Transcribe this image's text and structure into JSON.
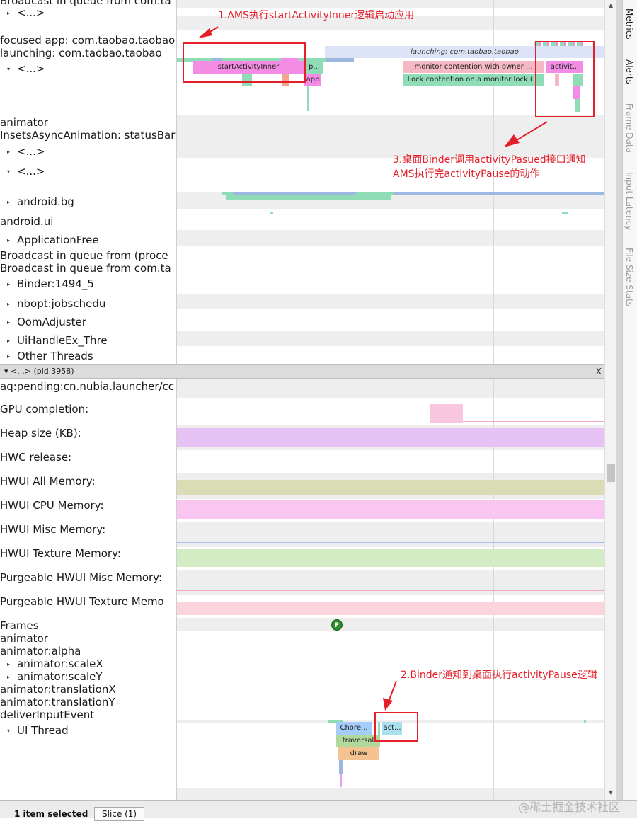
{
  "labels_top": [
    {
      "text": "Broadcast in queue from com.ta",
      "indent": false,
      "tri": ""
    },
    {
      "text": "<...>",
      "indent": true,
      "tri": "▸"
    },
    {
      "text": "focused app: com.taobao.taobao",
      "indent": false,
      "tri": ""
    },
    {
      "text": "launching: com.taobao.taobao",
      "indent": false,
      "tri": ""
    },
    {
      "text": "<...>",
      "indent": true,
      "tri": "▾"
    },
    {
      "text": "animator",
      "indent": false,
      "tri": ""
    },
    {
      "text": "InsetsAsyncAnimation: statusBar",
      "indent": false,
      "tri": ""
    },
    {
      "text": "<...>",
      "indent": true,
      "tri": "▸"
    },
    {
      "text": "<...>",
      "indent": true,
      "tri": "▾"
    },
    {
      "text": "android.bg",
      "indent": true,
      "tri": "▸"
    },
    {
      "text": "android.ui",
      "indent": false,
      "tri": ""
    },
    {
      "text": "ApplicationFree",
      "indent": true,
      "tri": "▸"
    },
    {
      "text": "Broadcast in queue from (proce",
      "indent": false,
      "tri": ""
    },
    {
      "text": "Broadcast in queue from com.ta",
      "indent": false,
      "tri": ""
    },
    {
      "text": "Binder:1494_5",
      "indent": true,
      "tri": "▸"
    },
    {
      "text": "nbopt:jobschedu",
      "indent": true,
      "tri": "▸"
    },
    {
      "text": "OomAdjuster",
      "indent": true,
      "tri": "▸"
    },
    {
      "text": "UiHandleEx_Thre",
      "indent": true,
      "tri": "▸"
    },
    {
      "text": "Other Threads",
      "indent": true,
      "tri": "▸"
    }
  ],
  "process_header": {
    "label": "▾ <...> (pid 3958)",
    "close": "X"
  },
  "labels_bottom": [
    {
      "text": "aq:pending:cn.nubia.launcher/cc",
      "indent": false,
      "tri": ""
    },
    {
      "text": "GPU completion:",
      "indent": false,
      "tri": ""
    },
    {
      "text": "Heap size (KB):",
      "indent": false,
      "tri": ""
    },
    {
      "text": "HWC release:",
      "indent": false,
      "tri": ""
    },
    {
      "text": "HWUI All Memory:",
      "indent": false,
      "tri": ""
    },
    {
      "text": "HWUI CPU Memory:",
      "indent": false,
      "tri": ""
    },
    {
      "text": "HWUI Misc Memory:",
      "indent": false,
      "tri": ""
    },
    {
      "text": "HWUI Texture Memory:",
      "indent": false,
      "tri": ""
    },
    {
      "text": "Purgeable HWUI Misc Memory:",
      "indent": false,
      "tri": ""
    },
    {
      "text": "Purgeable HWUI Texture Memo",
      "indent": false,
      "tri": ""
    },
    {
      "text": "Frames",
      "indent": false,
      "tri": ""
    },
    {
      "text": "animator",
      "indent": false,
      "tri": ""
    },
    {
      "text": "animator:alpha",
      "indent": false,
      "tri": ""
    },
    {
      "text": "animator:scaleX",
      "indent": true,
      "tri": "▸"
    },
    {
      "text": "animator:scaleY",
      "indent": true,
      "tri": "▸"
    },
    {
      "text": "animator:translationX",
      "indent": false,
      "tri": ""
    },
    {
      "text": "animator:translationY",
      "indent": false,
      "tri": ""
    },
    {
      "text": "deliverInputEvent",
      "indent": false,
      "tri": ""
    },
    {
      "text": "UI Thread",
      "indent": true,
      "tri": "▾"
    }
  ],
  "slices": {
    "launching": "launching: com.taobao.taobao",
    "start_activity_inner": "startActivityInner",
    "p": "p...",
    "app": "app",
    "monitor_contention": "monitor contention with owner ...",
    "lock_contention": "Lock contention on a monitor lock (...",
    "activit": "activit...",
    "chore": "Chore...",
    "act": "act...",
    "traversal": "traversal",
    "draw": "draw",
    "frame_marker": "F"
  },
  "annotations": {
    "a1": "1.AMS执行startActivityInner逻辑启动应用",
    "a3_line1": "3.桌面Binder调用activityPasued接口通知",
    "a3_line2": "AMS执行完activityPause的动作",
    "a2": "2.Binder通知到桌面执行activityPause逻辑"
  },
  "side_tabs": [
    {
      "label": "Metrics",
      "active": true
    },
    {
      "label": "Alerts",
      "active": true
    },
    {
      "label": "Frame Data",
      "active": false
    },
    {
      "label": "Input Latency",
      "active": false
    },
    {
      "label": "File Size Stats",
      "active": false
    }
  ],
  "status": {
    "selection": "1 item selected",
    "tab": "Slice (1)"
  },
  "watermark": "@稀土掘金技术社区",
  "colors": {
    "annotation": "#e5202a",
    "slice_pink": "#f48ce6",
    "slice_green": "#8fdcb6",
    "slice_rose": "#f6b8c4"
  }
}
